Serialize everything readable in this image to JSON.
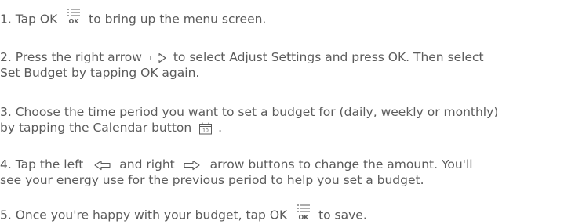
{
  "steps": [
    {
      "number": "1.",
      "before": "Tap OK",
      "icon": "ok-menu-icon",
      "after": "to bring up the menu screen."
    },
    {
      "number": "2.",
      "before": "Press the right arrow",
      "icon": "right-arrow-icon",
      "after": "to select Adjust Settings and press OK. Then select",
      "line2": "Set Budget by tapping OK again."
    },
    {
      "number": "3.",
      "line1": "Choose the time period you want to set a budget for (daily, weekly or monthly)",
      "before": "by tapping the Calendar button",
      "icon": "calendar-icon",
      "icon_text": "10",
      "after": "."
    },
    {
      "number": "4.",
      "before": "Tap the left",
      "icon": "left-arrow-icon",
      "middle": "and right",
      "icon2": "right-arrow-icon",
      "after": "arrow buttons to change the amount. You'll",
      "line2": "see your energy use for the previous period to help you set a budget."
    },
    {
      "number": "5.",
      "before": "Once you're happy with your budget, tap OK",
      "icon": "ok-menu-icon",
      "after": "to save."
    }
  ],
  "ok_icon_text": "OK",
  "text_color": "#5b5b5b"
}
